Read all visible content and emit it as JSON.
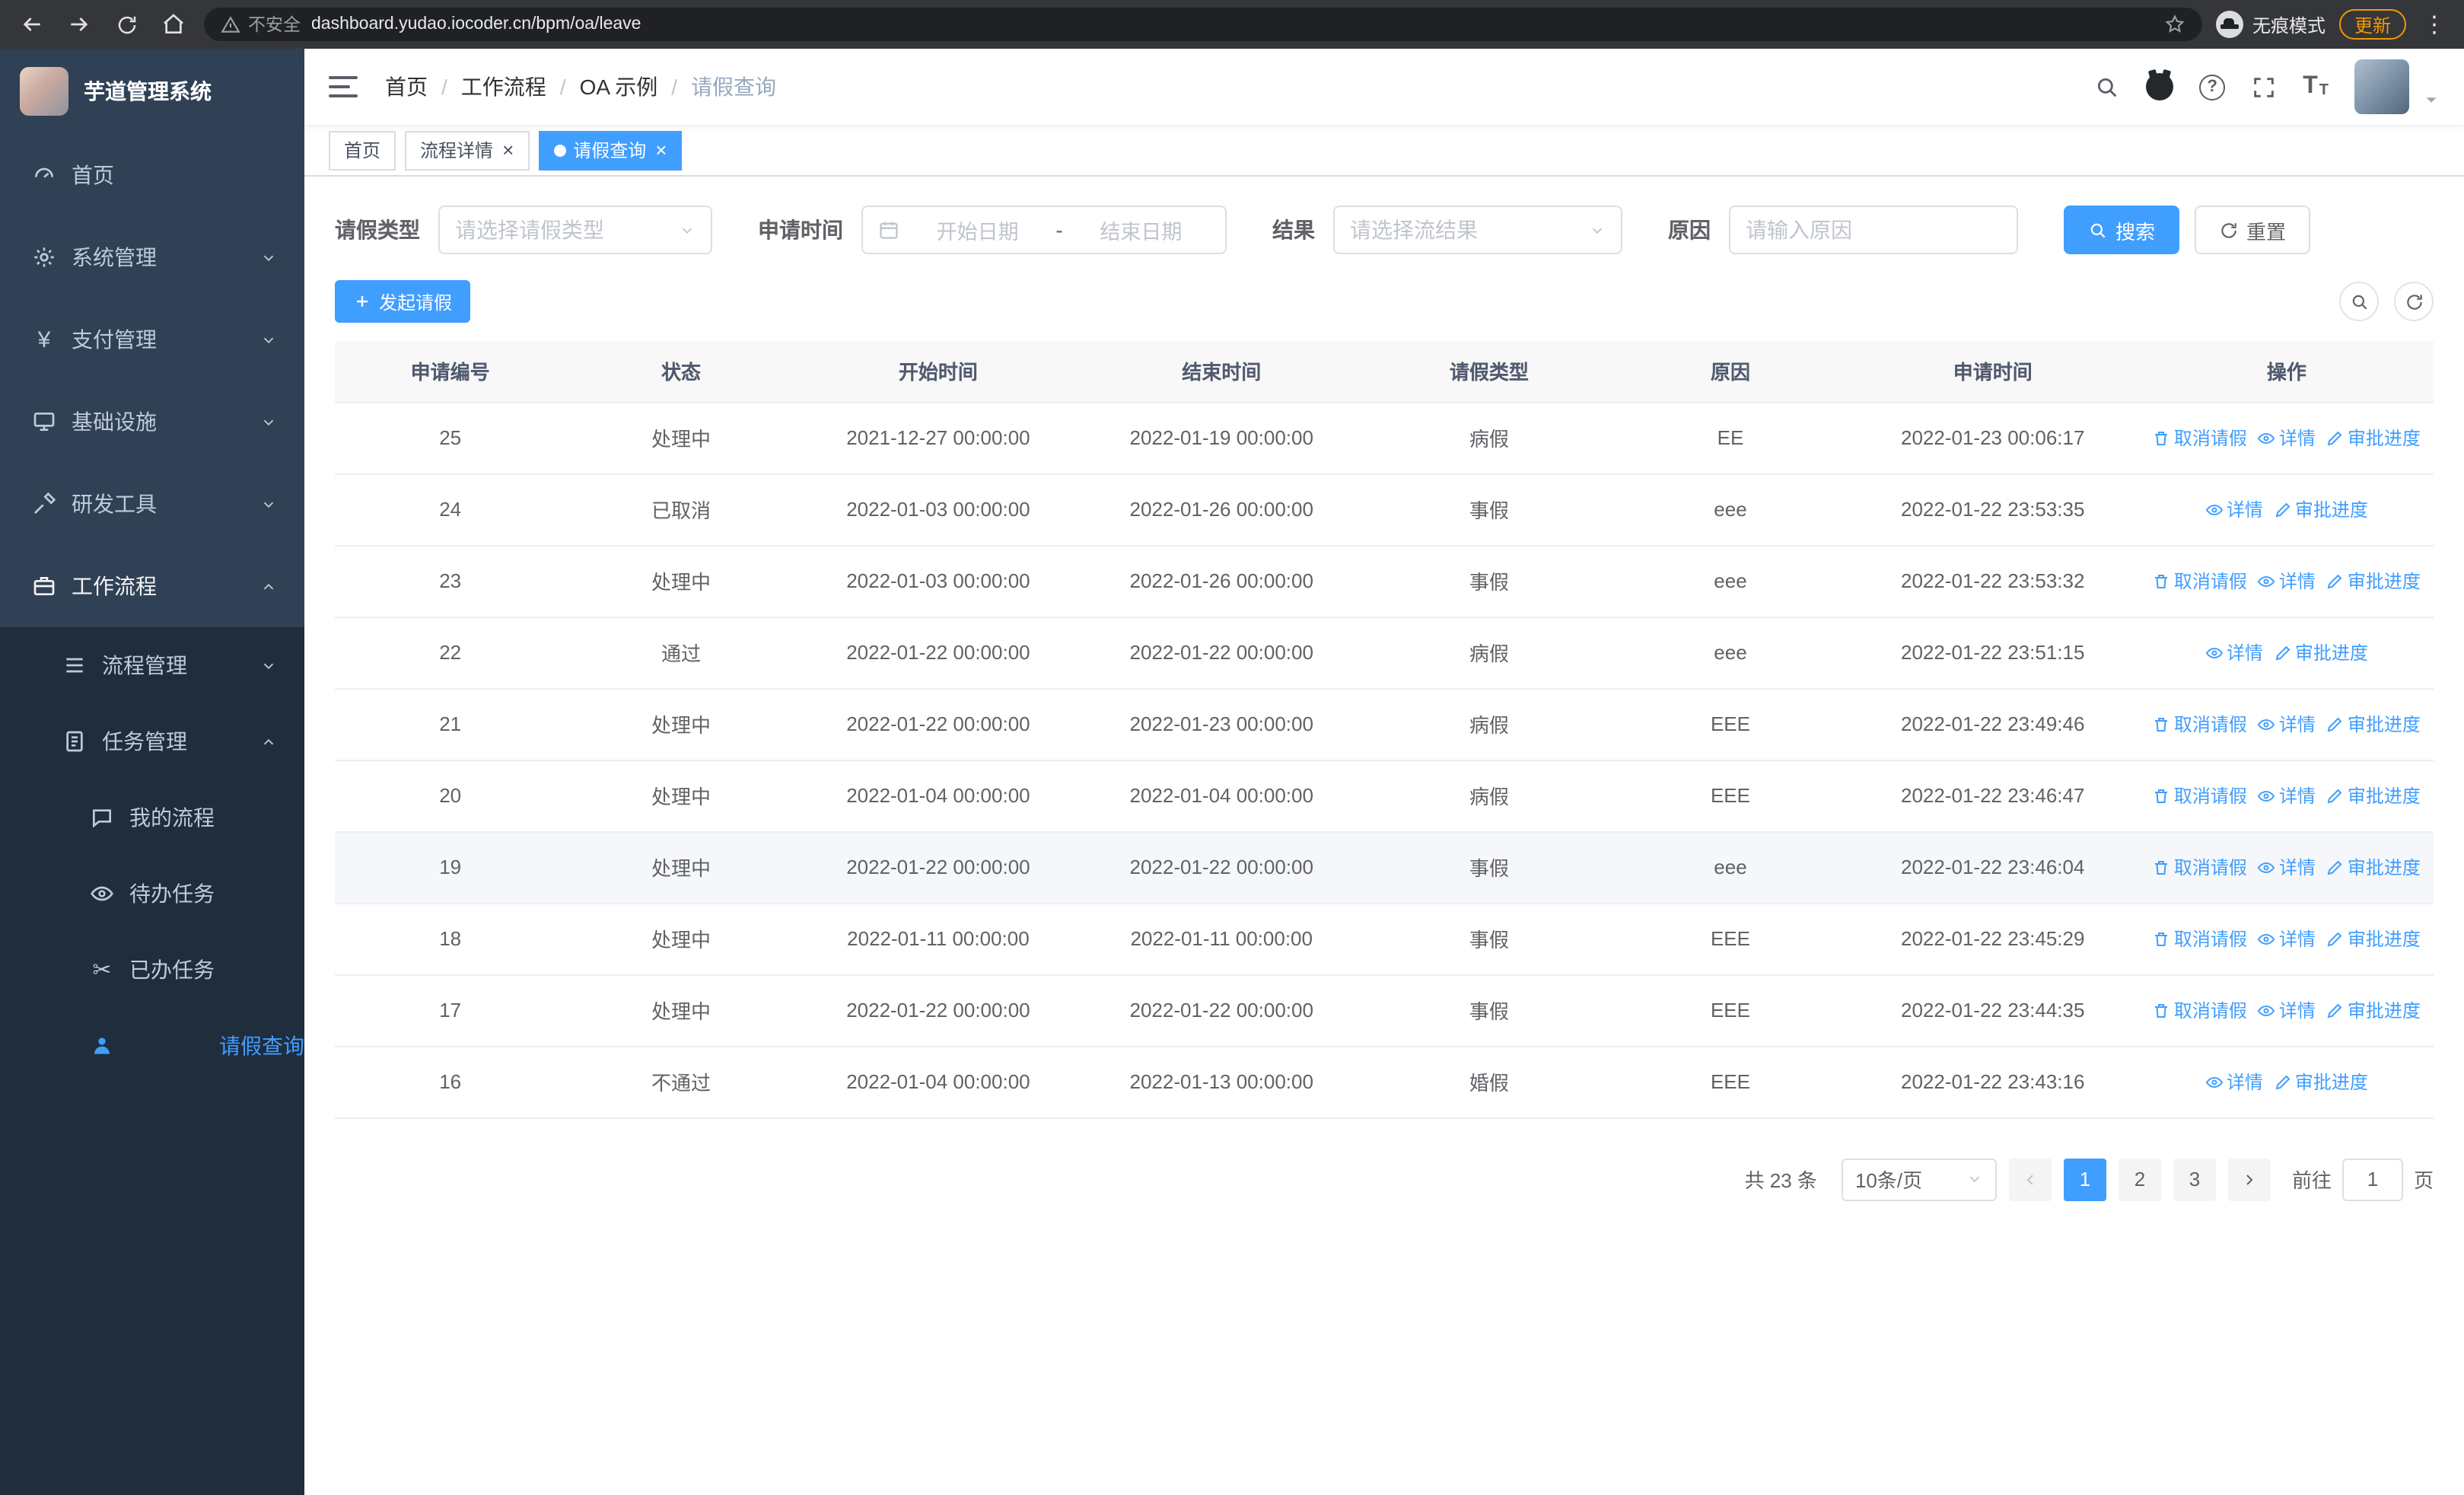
{
  "browser": {
    "security_warning": "不安全",
    "url": "dashboard.yudao.iocoder.cn/bpm/oa/leave",
    "incognito_label": "无痕模式",
    "update_label": "更新"
  },
  "sidebar": {
    "logo_title": "芋道管理系统",
    "items": [
      {
        "id": "home",
        "label": "首页",
        "icon": "dashboard",
        "level": 1
      },
      {
        "id": "system",
        "label": "系统管理",
        "icon": "gear",
        "level": 1,
        "chevron": "down"
      },
      {
        "id": "payment",
        "label": "支付管理",
        "icon": "yen",
        "level": 1,
        "chevron": "down"
      },
      {
        "id": "infrastructure",
        "label": "基础设施",
        "icon": "monitor",
        "level": 1,
        "chevron": "down"
      },
      {
        "id": "devtools",
        "label": "研发工具",
        "icon": "tool",
        "level": 1,
        "chevron": "down"
      },
      {
        "id": "workflow",
        "label": "工作流程",
        "icon": "workflow",
        "level": 1,
        "chevron": "up",
        "active": true
      },
      {
        "id": "process-mgmt",
        "label": "流程管理",
        "icon": "list",
        "level": 2,
        "chevron": "down"
      },
      {
        "id": "task-mgmt",
        "label": "任务管理",
        "icon": "task",
        "level": 2,
        "chevron": "up"
      },
      {
        "id": "my-process",
        "label": "我的流程",
        "icon": "message",
        "level": 3
      },
      {
        "id": "todo-task",
        "label": "待办任务",
        "icon": "eye",
        "level": 3
      },
      {
        "id": "done-task",
        "label": "已办任务",
        "icon": "scissors",
        "level": 3
      },
      {
        "id": "leave-query",
        "label": "请假查询",
        "icon": "person",
        "level": 3,
        "selected": true
      }
    ]
  },
  "header": {
    "breadcrumb": [
      "首页",
      "工作流程",
      "OA 示例",
      "请假查询"
    ]
  },
  "tabs": [
    {
      "label": "首页"
    },
    {
      "label": "流程详情",
      "closable": true
    },
    {
      "label": "请假查询",
      "closable": true,
      "active": true
    }
  ],
  "filters": {
    "leave_type_label": "请假类型",
    "leave_type_placeholder": "请选择请假类型",
    "apply_time_label": "申请时间",
    "start_date_placeholder": "开始日期",
    "date_separator": "-",
    "end_date_placeholder": "结束日期",
    "result_label": "结果",
    "result_placeholder": "请选择流结果",
    "reason_label": "原因",
    "reason_placeholder": "请输入原因",
    "search_label": "搜索",
    "reset_label": "重置"
  },
  "toolbar": {
    "create_label": "发起请假"
  },
  "table": {
    "columns": [
      "申请编号",
      "状态",
      "开始时间",
      "结束时间",
      "请假类型",
      "原因",
      "申请时间",
      "操作"
    ],
    "action_labels": {
      "cancel": "取消请假",
      "detail": "详情",
      "progress": "审批进度"
    },
    "rows": [
      {
        "no": "25",
        "status": "处理中",
        "start": "2021-12-27 00:00:00",
        "end": "2022-01-19 00:00:00",
        "type": "病假",
        "reason": "EE",
        "applied": "2022-01-23 00:06:17",
        "actions": [
          "cancel",
          "detail",
          "progress"
        ]
      },
      {
        "no": "24",
        "status": "已取消",
        "start": "2022-01-03 00:00:00",
        "end": "2022-01-26 00:00:00",
        "type": "事假",
        "reason": "eee",
        "applied": "2022-01-22 23:53:35",
        "actions": [
          "detail",
          "progress"
        ]
      },
      {
        "no": "23",
        "status": "处理中",
        "start": "2022-01-03 00:00:00",
        "end": "2022-01-26 00:00:00",
        "type": "事假",
        "reason": "eee",
        "applied": "2022-01-22 23:53:32",
        "actions": [
          "cancel",
          "detail",
          "progress"
        ]
      },
      {
        "no": "22",
        "status": "通过",
        "start": "2022-01-22 00:00:00",
        "end": "2022-01-22 00:00:00",
        "type": "病假",
        "reason": "eee",
        "applied": "2022-01-22 23:51:15",
        "actions": [
          "detail",
          "progress"
        ]
      },
      {
        "no": "21",
        "status": "处理中",
        "start": "2022-01-22 00:00:00",
        "end": "2022-01-23 00:00:00",
        "type": "病假",
        "reason": "EEE",
        "applied": "2022-01-22 23:49:46",
        "actions": [
          "cancel",
          "detail",
          "progress"
        ]
      },
      {
        "no": "20",
        "status": "处理中",
        "start": "2022-01-04 00:00:00",
        "end": "2022-01-04 00:00:00",
        "type": "病假",
        "reason": "EEE",
        "applied": "2022-01-22 23:46:47",
        "actions": [
          "cancel",
          "detail",
          "progress"
        ]
      },
      {
        "no": "19",
        "status": "处理中",
        "start": "2022-01-22 00:00:00",
        "end": "2022-01-22 00:00:00",
        "type": "事假",
        "reason": "eee",
        "applied": "2022-01-22 23:46:04",
        "actions": [
          "cancel",
          "detail",
          "progress"
        ],
        "hover": true
      },
      {
        "no": "18",
        "status": "处理中",
        "start": "2022-01-11 00:00:00",
        "end": "2022-01-11 00:00:00",
        "type": "事假",
        "reason": "EEE",
        "applied": "2022-01-22 23:45:29",
        "actions": [
          "cancel",
          "detail",
          "progress"
        ]
      },
      {
        "no": "17",
        "status": "处理中",
        "start": "2022-01-22 00:00:00",
        "end": "2022-01-22 00:00:00",
        "type": "事假",
        "reason": "EEE",
        "applied": "2022-01-22 23:44:35",
        "actions": [
          "cancel",
          "detail",
          "progress"
        ]
      },
      {
        "no": "16",
        "status": "不通过",
        "start": "2022-01-04 00:00:00",
        "end": "2022-01-13 00:00:00",
        "type": "婚假",
        "reason": "EEE",
        "applied": "2022-01-22 23:43:16",
        "actions": [
          "detail",
          "progress"
        ]
      }
    ]
  },
  "pagination": {
    "total": "共 23 条",
    "page_size": "10条/页",
    "pages": [
      "1",
      "2",
      "3"
    ],
    "active_page": "1",
    "goto_label": "前往",
    "goto_value": "1",
    "unit_label": "页"
  },
  "colors": {
    "primary": "#409eff",
    "sidebar_bg": "#304156",
    "submenu_bg": "#1f2d3d",
    "update_pill": "#f29900"
  }
}
